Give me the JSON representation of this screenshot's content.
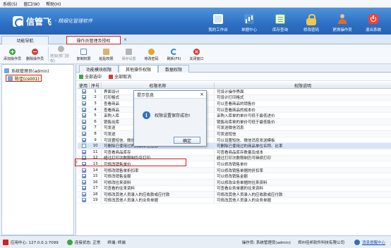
{
  "menu": [
    "系统(S)",
    "窗口(W)",
    "帮助(H)"
  ],
  "brand": {
    "name": "信管飞",
    "separator": "·",
    "subtitle": "精细化管理软件"
  },
  "topnav": [
    {
      "label": "我的工作台",
      "icon": "monitor-icon"
    },
    {
      "label": "单据中心",
      "icon": "chart-icon"
    },
    {
      "label": "库存查询",
      "icon": "document-icon"
    },
    {
      "label": "修改密码",
      "icon": "lock-icon"
    },
    {
      "label": "更换操作员",
      "icon": "user-icon"
    },
    {
      "label": "退出系统",
      "icon": "power-icon"
    }
  ],
  "doc_tabs": [
    "功能导航",
    "操作员管理及授权"
  ],
  "toolbar": [
    {
      "label": "添加操作员",
      "icon": "add-icon",
      "enabled": true
    },
    {
      "label": "删除操作员",
      "icon": "delete-icon",
      "enabled": true
    },
    {
      "label": "增加(部门授权)",
      "icon": "group-icon",
      "enabled": false
    },
    {
      "label": "复制权限",
      "icon": "copy-icon",
      "enabled": true
    },
    {
      "label": "粘贴权限",
      "icon": "paste-icon",
      "enabled": true
    },
    {
      "label": "保存设置",
      "icon": "save-icon",
      "enabled": false
    },
    {
      "label": "修改密码",
      "icon": "key-icon",
      "enabled": true
    },
    {
      "label": "刷新(F5)",
      "icon": "refresh-icon",
      "enabled": true
    },
    {
      "label": "关闭窗口",
      "icon": "close-icon",
      "enabled": true
    }
  ],
  "tree": [
    {
      "label": "系统管理员(admin)",
      "selected": false
    },
    {
      "label": "陈佳(cs001)",
      "selected": true
    }
  ],
  "sub_tabs": [
    "功能模块权限",
    "其他操作权限",
    "数据权限"
  ],
  "check_actions": {
    "all": "全部选中",
    "none": "全部取消"
  },
  "grid": {
    "headers": [
      "使用",
      "序号",
      "权限名称",
      "权限说明"
    ],
    "rows": [
      {
        "checked": true,
        "no": "1",
        "name": "界面设计",
        "desc": "可设计操作界面"
      },
      {
        "checked": true,
        "no": "2",
        "name": "打印格式",
        "desc": "可设计打印格式"
      },
      {
        "checked": true,
        "no": "3",
        "name": "查看商品",
        "desc": "可以查看商品的销售价"
      },
      {
        "checked": true,
        "no": "4",
        "name": "查看商品",
        "desc": "可以查看商品的成本价"
      },
      {
        "checked": true,
        "no": "5",
        "name": "采购入库",
        "desc": "采购入库单的单价可低于最低进价"
      },
      {
        "checked": true,
        "no": "6",
        "name": "销售出库",
        "desc": "销售出库单的单价可低于最低售价"
      },
      {
        "checked": true,
        "no": "7",
        "name": "可发送",
        "desc": "可发送微信消息"
      },
      {
        "checked": true,
        "no": "8",
        "name": "可发送",
        "desc": "可发送短信"
      },
      {
        "checked": true,
        "no": "9",
        "name": "可设置短信、微信消息发送模板",
        "desc": "可以设置短信、微信消息发送模板"
      },
      {
        "checked": false,
        "no": "10",
        "name": "可删除已使用过的商品单位信息",
        "desc": "可删除已使用过的商品单位名称、比率"
      },
      {
        "checked": true,
        "no": "11",
        "name": "可查看商品库存",
        "desc": "可查看商品库存数量及成本"
      },
      {
        "checked": true,
        "no": "12",
        "name": "超过打印次数限制仍可打印",
        "desc": "超过打印次数限制仍可继续打印"
      },
      {
        "checked": true,
        "no": "13",
        "name": "可修改销售单价",
        "desc": "可以修改销售单价"
      },
      {
        "checked": true,
        "no": "14",
        "name": "可修改销售单折扣率",
        "desc": "可以修改销售单据的折扣率"
      },
      {
        "checked": true,
        "no": "15",
        "name": "可修改销售金额",
        "desc": "可以修改销售金额"
      },
      {
        "checked": true,
        "no": "16",
        "name": "可修改往来资料",
        "desc": "可以修改业务单据的往来资料"
      },
      {
        "checked": true,
        "no": "17",
        "name": "可查看的往来资料",
        "desc": "可查看业务单据的往来资料"
      },
      {
        "checked": true,
        "no": "18",
        "name": "可修改其他人员录入的应收款或应付款",
        "desc": "可修改其他人员录入的应收款或应付款"
      },
      {
        "checked": true,
        "no": "19",
        "name": "可修改其他人员录入的业务单据",
        "desc": "可修改其他人员录入的业务单据"
      }
    ]
  },
  "dialog": {
    "title": "提示信息",
    "message": "权限设置保存成功!",
    "ok": "确定",
    "close": "×"
  },
  "cursor_text": "I",
  "status": {
    "app_center": "应用中心: 127.0.0.1:7099",
    "connection": "连接状态: 正常",
    "station": "终端: 终端",
    "operator": "操作员: 系统管理员(admin)",
    "company": "郑州佳邦软件科技有限公司",
    "message_link": "消息提醒中心"
  }
}
